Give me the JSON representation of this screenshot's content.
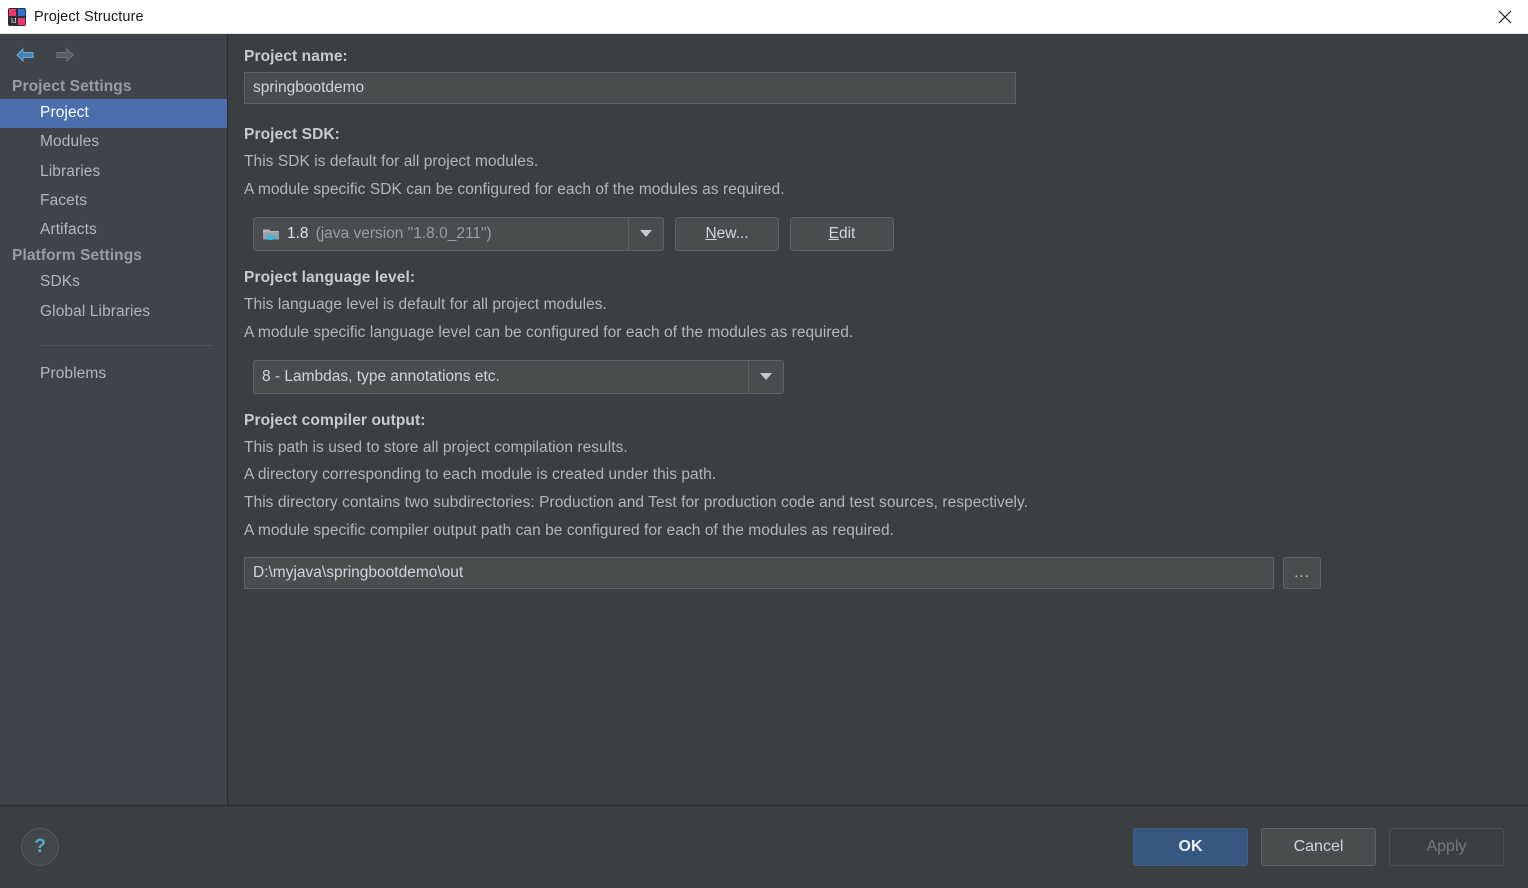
{
  "window": {
    "title": "Project Structure",
    "app_icon": "intellij-idea-icon",
    "close_label": "✕"
  },
  "navigation": {
    "back_icon": "arrow-left-icon",
    "forward_icon": "arrow-right-icon"
  },
  "sidebar": {
    "groups": [
      {
        "title": "Project Settings",
        "items": [
          {
            "label": "Project",
            "selected": true
          },
          {
            "label": "Modules",
            "selected": false
          },
          {
            "label": "Libraries",
            "selected": false
          },
          {
            "label": "Facets",
            "selected": false
          },
          {
            "label": "Artifacts",
            "selected": false
          }
        ]
      },
      {
        "title": "Platform Settings",
        "items": [
          {
            "label": "SDKs",
            "selected": false
          },
          {
            "label": "Global Libraries",
            "selected": false
          }
        ]
      }
    ],
    "extra_items": [
      {
        "label": "Problems",
        "selected": false
      }
    ]
  },
  "main": {
    "project_name": {
      "label": "Project name:",
      "value": "springbootdemo",
      "placeholder": ""
    },
    "project_sdk": {
      "label": "Project SDK:",
      "description_lines": [
        "This SDK is default for all project modules.",
        "A module specific SDK can be configured for each of the modules as required."
      ],
      "selected_name": "1.8",
      "selected_version": "(java version \"1.8.0_211\")",
      "icon": "java-sdk-folder-icon",
      "dropdown_icon": "chevron-down-icon",
      "new_button": "New...",
      "new_button_mnemonic": "N",
      "edit_button": "Edit",
      "edit_button_mnemonic": "E"
    },
    "language_level": {
      "label": "Project language level:",
      "description_lines": [
        "This language level is default for all project modules.",
        "A module specific language level can be configured for each of the modules as required."
      ],
      "selected": "8 - Lambdas, type annotations etc.",
      "dropdown_icon": "chevron-down-icon"
    },
    "compiler_output": {
      "label": "Project compiler output:",
      "description_lines": [
        "This path is used to store all project compilation results.",
        "A directory corresponding to each module is created under this path.",
        "This directory contains two subdirectories: Production and Test for production code and test sources, respectively.",
        "A module specific compiler output path can be configured for each of the modules as required."
      ],
      "value": "D:\\myjava\\springbootdemo\\out",
      "placeholder": "",
      "browse_label": "..."
    }
  },
  "footer": {
    "help_label": "?",
    "help_icon": "help-question-icon",
    "ok_label": "OK",
    "cancel_label": "Cancel",
    "apply_label": "Apply"
  },
  "colors": {
    "panel_bg": "#3c3f41",
    "sidebar_bg": "#3f434a",
    "selection_blue": "#4b6eaf",
    "primary_button": "#365880",
    "field_bg": "#4a4d4e",
    "text": "#b4b7ba",
    "titlebar_bg": "#ffffff",
    "accent_cyan": "#5aa8c8"
  }
}
